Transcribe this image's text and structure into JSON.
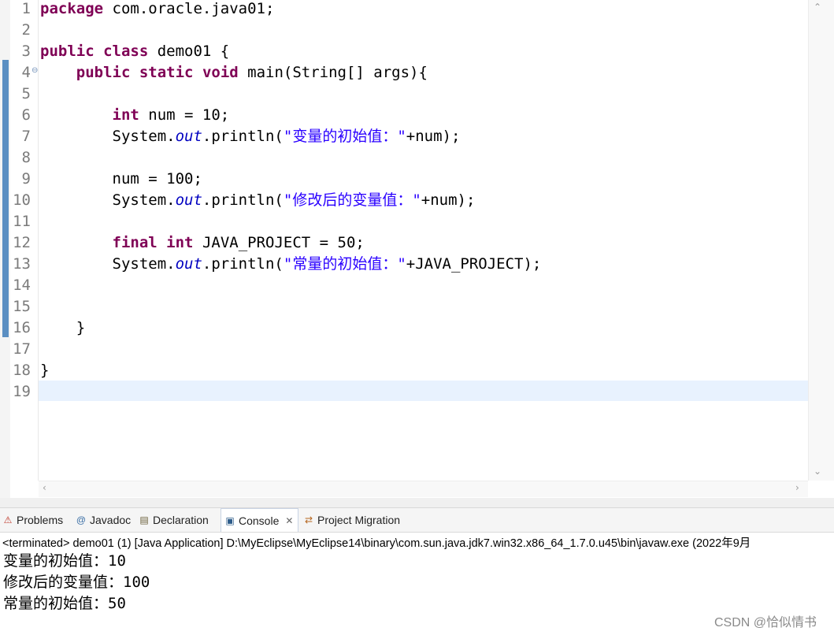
{
  "editor": {
    "line_numbers": [
      "1",
      "2",
      "3",
      "4",
      "5",
      "6",
      "7",
      "8",
      "9",
      "10",
      "11",
      "12",
      "13",
      "14",
      "15",
      "16",
      "17",
      "18",
      "19"
    ],
    "lines": {
      "l1_kw": "package",
      "l1_rest": " com.oracle.java01;",
      "l3_kw1": "public",
      "l3_sp": " ",
      "l3_kw2": "class",
      "l3_rest": " demo01 {",
      "l4_indent": "    ",
      "l4_kw1": "public",
      "l4_kw2": "static",
      "l4_kw3": "void",
      "l4_rest": " main(String[] args){",
      "l6_indent": "        ",
      "l6_kw": "int",
      "l6_rest": " num = 10;",
      "l7_pre": "        System.",
      "l7_fld": "out",
      "l7_mid": ".println(",
      "l7_str": "\"变量的初始值：\"",
      "l7_post": "+num);",
      "l9": "        num = 100;",
      "l10_pre": "        System.",
      "l10_fld": "out",
      "l10_mid": ".println(",
      "l10_str": "\"修改后的变量值：\"",
      "l10_post": "+num);",
      "l12_indent": "        ",
      "l12_kw1": "final",
      "l12_kw2": "int",
      "l12_rest": " JAVA_PROJECT = 50;",
      "l13_pre": "        System.",
      "l13_fld": "out",
      "l13_mid": ".println(",
      "l13_str": "\"常量的初始值：\"",
      "l13_post": "+JAVA_PROJECT);",
      "l16": "    }",
      "l18": "}"
    },
    "fold_marker": "⊖"
  },
  "tabs": [
    {
      "label": "Problems",
      "icon": "problems-icon",
      "glyph": "⚠"
    },
    {
      "label": "Javadoc",
      "icon": "javadoc-icon",
      "glyph": "@"
    },
    {
      "label": "Declaration",
      "icon": "declaration-icon",
      "glyph": "▤"
    },
    {
      "label": "Console",
      "icon": "console-icon",
      "glyph": "▣",
      "active": true
    },
    {
      "label": "Project Migration",
      "icon": "project-migration-icon",
      "glyph": "⇄"
    }
  ],
  "console": {
    "close_glyph": "✕",
    "status": "<terminated> demo01 (1) [Java Application] D:\\MyEclipse\\MyEclipse14\\binary\\com.sun.java.jdk7.win32.x86_64_1.7.0.u45\\bin\\javaw.exe (2022年9月",
    "output": [
      "变量的初始值：10",
      "修改后的变量值：100",
      "常量的初始值：50"
    ]
  },
  "watermark": "CSDN @恰似情书",
  "colors": {
    "keyword": "#7f0055",
    "field": "#0000c0",
    "string": "#2a00ff",
    "current_line": "#e8f2fe",
    "ruler": "#5b8fc2"
  }
}
